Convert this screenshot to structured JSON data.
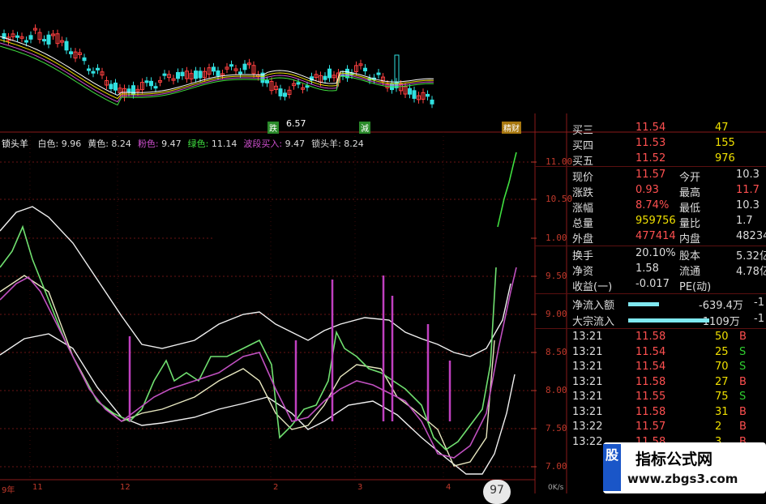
{
  "indicator_header": {
    "name": "锁头羊",
    "items": [
      {
        "label": "白色:",
        "value": "9.96",
        "color": "#ffffff"
      },
      {
        "label": "黄色:",
        "value": "8.24",
        "color": "#f0e000"
      },
      {
        "label": "粉色:",
        "value": "9.47",
        "color": "#d050d0"
      },
      {
        "label": "绿色:",
        "value": "11.14",
        "color": "#40e040"
      },
      {
        "label": "波段买入:",
        "value": "9.47",
        "color": "#d050d0"
      },
      {
        "label": "锁头羊:",
        "value": "8.24",
        "color": "#ffffff"
      }
    ]
  },
  "price_axis": [
    "11.00",
    "10.50",
    "1.00",
    "9.50",
    "9.00",
    "8.50",
    "8.00",
    "7.50",
    "7.00"
  ],
  "candle_markers": {
    "low_label": "6.57",
    "tag_down": "跌",
    "tag_mid": "減",
    "tag_right": "精财"
  },
  "time_axis": [
    "11",
    "12",
    "2",
    "3",
    "4"
  ],
  "bottom_left": "9年",
  "quote": {
    "sell_rows": [
      {
        "label": "买三",
        "price": "11.54",
        "vol": "47"
      },
      {
        "label": "买四",
        "price": "11.53",
        "vol": "155"
      },
      {
        "label": "买五",
        "price": "11.52",
        "vol": "976"
      }
    ],
    "stats": [
      {
        "l1": "现价",
        "v1": "11.57",
        "l2": "今开",
        "v2": "10.3"
      },
      {
        "l1": "涨跌",
        "v1": "0.93",
        "l2": "最高",
        "v2": "11.7"
      },
      {
        "l1": "涨幅",
        "v1": "8.74%",
        "l2": "最低",
        "v2": "10.3"
      },
      {
        "l1": "总量",
        "v1": "959756",
        "l2": "量比",
        "v2": "1.7"
      },
      {
        "l1": "外盘",
        "v1": "477414",
        "l2": "内盘",
        "v2": "48234"
      }
    ],
    "stats2": [
      {
        "l1": "换手",
        "v1": "20.10%",
        "l2": "股本",
        "v2": "5.32亿"
      },
      {
        "l1": "净资",
        "v1": "1.58",
        "l2": "流通",
        "v2": "4.78亿"
      },
      {
        "l1": "收益(一)",
        "v1": "-0.017",
        "l2": "PE(动)",
        "v2": ""
      }
    ],
    "flows": [
      {
        "label": "净流入额",
        "value": "-639.4万",
        "extra": "-1"
      },
      {
        "label": "大宗流入",
        "value": "-1109万",
        "extra": "-1"
      }
    ],
    "ticks": [
      {
        "time": "13:21",
        "price": "11.58",
        "vol": "50",
        "side": "B"
      },
      {
        "time": "13:21",
        "price": "11.54",
        "vol": "25",
        "side": "S"
      },
      {
        "time": "13:21",
        "price": "11.54",
        "vol": "70",
        "side": "S"
      },
      {
        "time": "13:21",
        "price": "11.58",
        "vol": "27",
        "side": "B"
      },
      {
        "time": "13:21",
        "price": "11.55",
        "vol": "75",
        "side": "S"
      },
      {
        "time": "13:21",
        "price": "11.58",
        "vol": "31",
        "side": "B"
      },
      {
        "time": "13:22",
        "price": "11.57",
        "vol": "2",
        "side": "B"
      },
      {
        "time": "13:22",
        "price": "11.58",
        "vol": "3",
        "side": "B"
      }
    ]
  },
  "status": {
    "speed": "97",
    "rate": "0K/s"
  },
  "watermark": {
    "title": "指标公式网",
    "url": "www.zbgs3.com",
    "logo": "股"
  },
  "colors": {
    "red": "#e03030",
    "green": "#30d030",
    "up": "#ff4040",
    "down": "#30e0e0",
    "grid": "#5a1010"
  }
}
